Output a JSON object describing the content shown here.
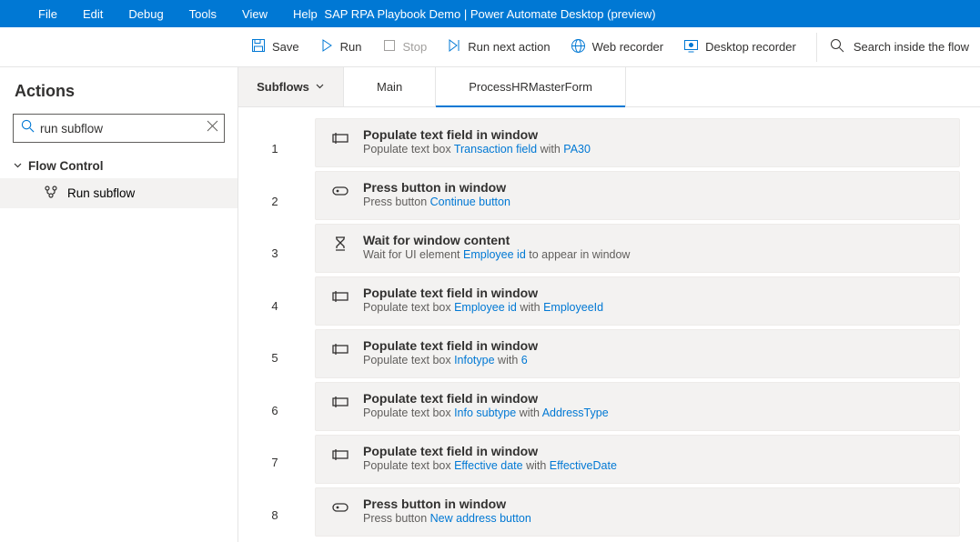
{
  "menubar": {
    "items": [
      "File",
      "Edit",
      "Debug",
      "Tools",
      "View",
      "Help"
    ],
    "title": "SAP RPA Playbook Demo | Power Automate Desktop (preview)"
  },
  "toolbar": {
    "save": "Save",
    "run": "Run",
    "stop": "Stop",
    "run_next": "Run next action",
    "web_recorder": "Web recorder",
    "desktop_recorder": "Desktop recorder",
    "search_placeholder": "Search inside the flow"
  },
  "sidebar": {
    "heading": "Actions",
    "search_value": "run subflow",
    "group": "Flow Control",
    "item": "Run subflow"
  },
  "tabs": {
    "subflows": "Subflows",
    "main": "Main",
    "active": "ProcessHRMasterForm"
  },
  "steps": [
    {
      "num": "1",
      "icon": "textbox",
      "title": "Populate text field in window",
      "desc": [
        {
          "t": "Populate text box "
        },
        {
          "t": "Transaction field",
          "link": true
        },
        {
          "t": " with "
        },
        {
          "t": "PA30",
          "link": true
        }
      ]
    },
    {
      "num": "2",
      "icon": "button",
      "title": "Press button in window",
      "desc": [
        {
          "t": "Press button "
        },
        {
          "t": "Continue button",
          "link": true
        }
      ]
    },
    {
      "num": "3",
      "icon": "hourglass",
      "title": "Wait for window content",
      "desc": [
        {
          "t": "Wait for UI element "
        },
        {
          "t": "Employee id",
          "link": true
        },
        {
          "t": " to appear in window"
        }
      ]
    },
    {
      "num": "4",
      "icon": "textbox",
      "title": "Populate text field in window",
      "desc": [
        {
          "t": "Populate text box "
        },
        {
          "t": "Employee id",
          "link": true
        },
        {
          "t": " with   "
        },
        {
          "t": "EmployeeId",
          "link": true
        }
      ]
    },
    {
      "num": "5",
      "icon": "textbox",
      "title": "Populate text field in window",
      "desc": [
        {
          "t": "Populate text box "
        },
        {
          "t": "Infotype",
          "link": true
        },
        {
          "t": " with "
        },
        {
          "t": "6",
          "link": true
        }
      ]
    },
    {
      "num": "6",
      "icon": "textbox",
      "title": "Populate text field in window",
      "desc": [
        {
          "t": "Populate text box "
        },
        {
          "t": "Info subtype",
          "link": true
        },
        {
          "t": " with   "
        },
        {
          "t": "AddressType",
          "link": true
        }
      ]
    },
    {
      "num": "7",
      "icon": "textbox",
      "title": "Populate text field in window",
      "desc": [
        {
          "t": "Populate text box "
        },
        {
          "t": "Effective date",
          "link": true
        },
        {
          "t": " with   "
        },
        {
          "t": "EffectiveDate",
          "link": true
        }
      ]
    },
    {
      "num": "8",
      "icon": "button",
      "title": "Press button in window",
      "desc": [
        {
          "t": "Press button "
        },
        {
          "t": "New address button",
          "link": true
        }
      ]
    }
  ]
}
